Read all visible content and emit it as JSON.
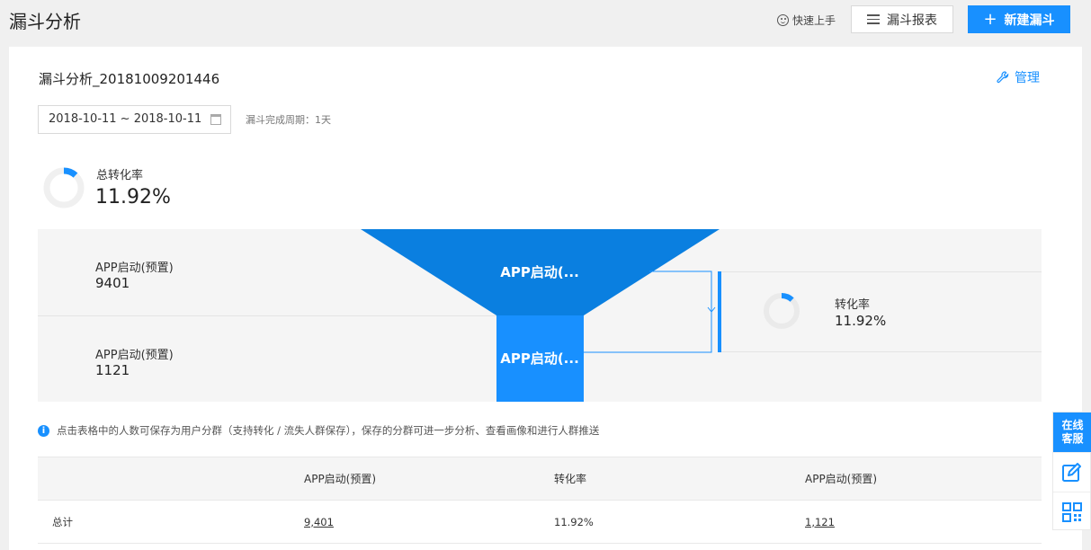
{
  "header": {
    "title": "漏斗分析",
    "quick_start": "快速上手",
    "report_button": "漏斗报表",
    "new_button": "新建漏斗"
  },
  "card": {
    "funnel_name": "漏斗分析_20181009201446",
    "manage": "管理",
    "date_range": "2018-10-11 ~ 2018-10-11",
    "cycle": "漏斗完成周期：1天"
  },
  "overall": {
    "label": "总转化率",
    "value": "11.92%",
    "rate": 0.1192
  },
  "funnel": {
    "steps": [
      {
        "label": "APP启动(预置)",
        "value": "9401",
        "shape_label": "APP启动(..."
      },
      {
        "label": "APP启动(预置)",
        "value": "1121",
        "shape_label": "APP启动(..."
      }
    ],
    "conversion": {
      "label": "转化率",
      "value": "11.92%",
      "rate": 0.1192
    }
  },
  "tip": "点击表格中的人数可保存为用户分群（支持转化 / 流失人群保存），保存的分群可进一步分析、查看画像和进行人群推送",
  "table": {
    "headers": [
      "APP启动(预置)",
      "转化率",
      "APP启动(预置)"
    ],
    "rows": [
      {
        "name": "总计",
        "step1": "9,401",
        "rate": "11.92%",
        "step2": "1,121"
      }
    ]
  },
  "float": {
    "chat": "在线客服"
  },
  "colors": {
    "accent": "#1890ff",
    "funnel_top": "#0a7fe0",
    "funnel_bottom": "#1890ff"
  }
}
